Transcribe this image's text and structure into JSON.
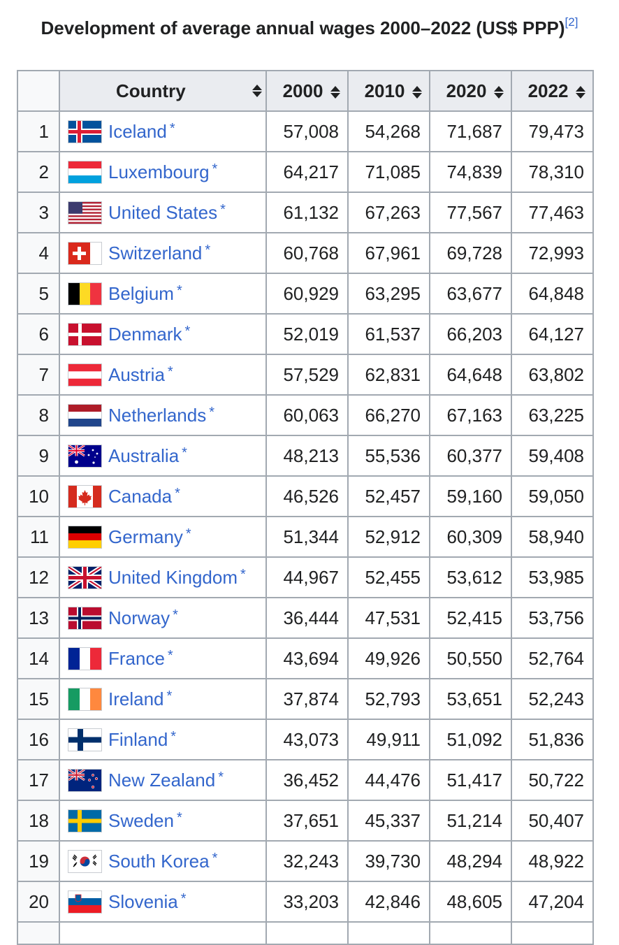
{
  "caption": {
    "title": "Development of average annual wages 2000–2022 (US$ PPP)",
    "ref": "[2]"
  },
  "headers": {
    "rank": "",
    "country": "Country",
    "y2000": "2000",
    "y2010": "2010",
    "y2020": "2020",
    "y2022": "2022"
  },
  "rows": [
    {
      "rank": "1",
      "country": "Iceland",
      "mark": "*",
      "flag": "iceland-flag-icon",
      "v2000": "57,008",
      "v2010": "54,268",
      "v2020": "71,687",
      "v2022": "79,473"
    },
    {
      "rank": "2",
      "country": "Luxembourg",
      "mark": "*",
      "flag": "luxembourg-flag-icon",
      "v2000": "64,217",
      "v2010": "71,085",
      "v2020": "74,839",
      "v2022": "78,310"
    },
    {
      "rank": "3",
      "country": "United States",
      "mark": "*",
      "flag": "united-states-flag-icon",
      "v2000": "61,132",
      "v2010": "67,263",
      "v2020": "77,567",
      "v2022": "77,463"
    },
    {
      "rank": "4",
      "country": "Switzerland",
      "mark": "*",
      "flag": "switzerland-flag-icon",
      "v2000": "60,768",
      "v2010": "67,961",
      "v2020": "69,728",
      "v2022": "72,993"
    },
    {
      "rank": "5",
      "country": "Belgium",
      "mark": "*",
      "flag": "belgium-flag-icon",
      "v2000": "60,929",
      "v2010": "63,295",
      "v2020": "63,677",
      "v2022": "64,848"
    },
    {
      "rank": "6",
      "country": "Denmark",
      "mark": "*",
      "flag": "denmark-flag-icon",
      "v2000": "52,019",
      "v2010": "61,537",
      "v2020": "66,203",
      "v2022": "64,127"
    },
    {
      "rank": "7",
      "country": "Austria",
      "mark": "*",
      "flag": "austria-flag-icon",
      "v2000": "57,529",
      "v2010": "62,831",
      "v2020": "64,648",
      "v2022": "63,802"
    },
    {
      "rank": "8",
      "country": "Netherlands",
      "mark": "*",
      "flag": "netherlands-flag-icon",
      "v2000": "60,063",
      "v2010": "66,270",
      "v2020": "67,163",
      "v2022": "63,225"
    },
    {
      "rank": "9",
      "country": "Australia",
      "mark": "*",
      "flag": "australia-flag-icon",
      "v2000": "48,213",
      "v2010": "55,536",
      "v2020": "60,377",
      "v2022": "59,408"
    },
    {
      "rank": "10",
      "country": "Canada",
      "mark": "*",
      "flag": "canada-flag-icon",
      "v2000": "46,526",
      "v2010": "52,457",
      "v2020": "59,160",
      "v2022": "59,050"
    },
    {
      "rank": "11",
      "country": "Germany",
      "mark": "*",
      "flag": "germany-flag-icon",
      "v2000": "51,344",
      "v2010": "52,912",
      "v2020": "60,309",
      "v2022": "58,940"
    },
    {
      "rank": "12",
      "country": "United Kingdom",
      "mark": "*",
      "flag": "united-kingdom-flag-icon",
      "v2000": "44,967",
      "v2010": "52,455",
      "v2020": "53,612",
      "v2022": "53,985"
    },
    {
      "rank": "13",
      "country": "Norway",
      "mark": "*",
      "flag": "norway-flag-icon",
      "v2000": "36,444",
      "v2010": "47,531",
      "v2020": "52,415",
      "v2022": "53,756"
    },
    {
      "rank": "14",
      "country": "France",
      "mark": "*",
      "flag": "france-flag-icon",
      "v2000": "43,694",
      "v2010": "49,926",
      "v2020": "50,550",
      "v2022": "52,764"
    },
    {
      "rank": "15",
      "country": "Ireland",
      "mark": "*",
      "flag": "ireland-flag-icon",
      "v2000": "37,874",
      "v2010": "52,793",
      "v2020": "53,651",
      "v2022": "52,243"
    },
    {
      "rank": "16",
      "country": "Finland",
      "mark": "*",
      "flag": "finland-flag-icon",
      "v2000": "43,073",
      "v2010": "49,911",
      "v2020": "51,092",
      "v2022": "51,836"
    },
    {
      "rank": "17",
      "country": "New Zealand",
      "mark": "*",
      "flag": "new-zealand-flag-icon",
      "v2000": "36,452",
      "v2010": "44,476",
      "v2020": "51,417",
      "v2022": "50,722"
    },
    {
      "rank": "18",
      "country": "Sweden",
      "mark": "*",
      "flag": "sweden-flag-icon",
      "v2000": "37,651",
      "v2010": "45,337",
      "v2020": "51,214",
      "v2022": "50,407"
    },
    {
      "rank": "19",
      "country": "South Korea",
      "mark": "*",
      "flag": "south-korea-flag-icon",
      "v2000": "32,243",
      "v2010": "39,730",
      "v2020": "48,294",
      "v2022": "48,922"
    },
    {
      "rank": "20",
      "country": "Slovenia",
      "mark": "*",
      "flag": "slovenia-flag-icon",
      "v2000": "33,203",
      "v2010": "42,846",
      "v2020": "48,605",
      "v2022": "47,204"
    }
  ]
}
